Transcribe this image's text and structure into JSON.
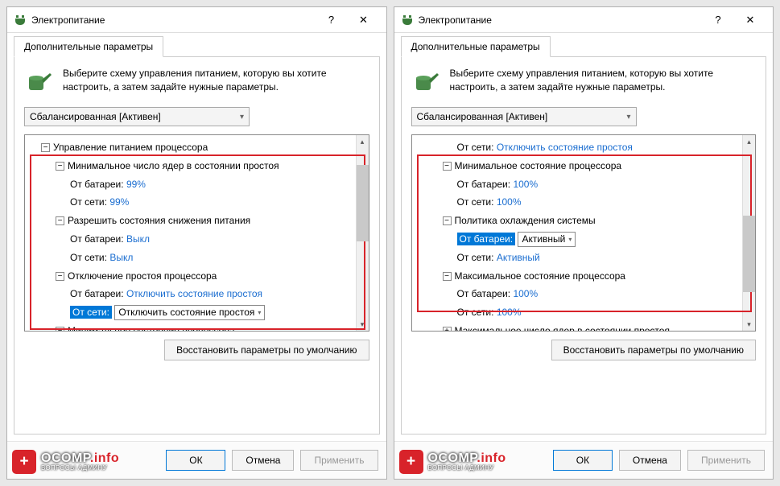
{
  "watermark": {
    "badge": "+",
    "brand": "OCOMP",
    "suffix": ".info",
    "sub": "ВОПРОСЫ АДМИНУ"
  },
  "left": {
    "title": "Электропитание",
    "help": "?",
    "tab": "Дополнительные параметры",
    "intro": "Выберите схему управления питанием, которую вы хотите настроить, а затем задайте нужные параметры.",
    "plan": "Сбалансированная [Активен]",
    "tree": {
      "n0": "Управление питанием процессора",
      "n1": "Минимальное число ядер в состоянии простоя",
      "n1a_l": "От батареи:",
      "n1a_v": "99%",
      "n1b_l": "От сети:",
      "n1b_v": "99%",
      "n2": "Разрешить состояния снижения питания",
      "n2a_l": "От батареи:",
      "n2a_v": "Выкл",
      "n2b_l": "От сети:",
      "n2b_v": "Выкл",
      "n3": "Отключение простоя процессора",
      "n3a_l": "От батареи:",
      "n3a_v": "Отключить состояние простоя",
      "n3b_l": "От сети:",
      "n3b_v": "Отключить состояние простоя",
      "n4": "Минимальное состояние процессора"
    },
    "restore": "Восстановить параметры по умолчанию",
    "ok": "ОК",
    "cancel": "Отмена",
    "apply": "Применить"
  },
  "right": {
    "title": "Электропитание",
    "help": "?",
    "tab": "Дополнительные параметры",
    "intro": "Выберите схему управления питанием, которую вы хотите настроить, а затем задайте нужные параметры.",
    "plan": "Сбалансированная [Активен]",
    "tree": {
      "t0_l": "От сети:",
      "t0_v": "Отключить состояние простоя",
      "n1": "Минимальное состояние процессора",
      "n1a_l": "От батареи:",
      "n1a_v": "100%",
      "n1b_l": "От сети:",
      "n1b_v": "100%",
      "n2": "Политика охлаждения системы",
      "n2a_l": "От батареи:",
      "n2a_v": "Активный",
      "n2b_l": "От сети:",
      "n2b_v": "Активный",
      "n3": "Максимальное состояние процессора",
      "n3a_l": "От батареи:",
      "n3a_v": "100%",
      "n3b_l": "От сети:",
      "n3b_v": "100%",
      "n4": "Максимальное число ядер в состоянии простоя"
    },
    "restore": "Восстановить параметры по умолчанию",
    "ok": "ОК",
    "cancel": "Отмена",
    "apply": "Применить"
  }
}
